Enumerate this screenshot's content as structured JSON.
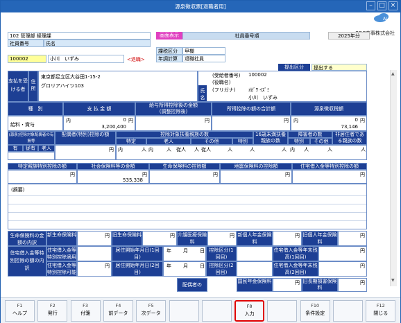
{
  "window": {
    "title": "源泉徴収票[退職者用]"
  },
  "company": "OBC商事株式会社",
  "employee": {
    "dept": "102 管理部 経理課",
    "label_no": "社員番号",
    "label_name": "氏名",
    "no": "100002",
    "name": "小川　いずみ",
    "status": "<退職>",
    "tax_class_label": "課税区分",
    "tax_class": "甲欄",
    "year_end_label": "年調計算",
    "year_end": "退職社員"
  },
  "display": {
    "label": "画面表示",
    "sort": "社員番号順",
    "year": "2025年分"
  },
  "submit": {
    "label": "提出区分",
    "value": "提出する"
  },
  "payee": {
    "label": "支払を受ける者",
    "addr_label": "住所",
    "address1": "東京都足立区大谷田1-15-2",
    "address2": "グロリアハイツ103",
    "recipient_no_label": "(受給者番号)",
    "recipient_no": "100002",
    "post_label": "(役職名)",
    "name_label": "氏名",
    "kana_label": "(フリガナ)",
    "kana": "ｵｶﾞﾜ ｲｽﾞﾐ",
    "name": "小川　いずみ"
  },
  "amounts": {
    "h_type": "種　別",
    "h_pay": "支 払 金 額",
    "h_after": "給与所得控除後の金額",
    "h_after2": "(調整控除後)",
    "h_deduct": "所得控除の額の合計額",
    "h_tax": "源泉徴収税額",
    "type": "給料・賞与",
    "inner": "内",
    "pay_zero": "0",
    "pay": "3,200,400",
    "yen": "円",
    "tax_zero": "0",
    "tax": "73,146"
  },
  "deps": {
    "h_spouse_flag": "(源泉)控除対象配偶者の有無等",
    "h_spouse": "配偶者(特別)控除の額",
    "h_dep_count": "控除対象扶養親族の数",
    "h_under16": "16歳未満扶養親族の数",
    "h_disabled": "障害者の数",
    "h_nonres": "非居住者である親族の数",
    "h_yes": "有",
    "h_junyu": "従有",
    "h_old": "老人",
    "h_special": "特定",
    "h_elder": "老人",
    "h_other": "その他",
    "h_tok": "特別",
    "h_otherd": "その他",
    "inner": "内",
    "person": "人",
    "from": "従人"
  },
  "ins": {
    "h_special_spouse": "特定親族特別控除の額",
    "h_social": "社会保険料等の金額",
    "h_life": "生命保険料の控除額",
    "h_quake": "地震保険料の控除額",
    "h_housing": "住宅借入金等特別控除の額",
    "social": "535,338",
    "yen": "円"
  },
  "memo": {
    "label": "(摘要)"
  },
  "details": {
    "life_breakdown": "生命保険料の金額の内訳",
    "new_life": "新生命保険料",
    "old_life": "旧生命保険料",
    "care": "介護医療保険料",
    "new_pension": "新個人年金保険料",
    "old_pension": "旧個人年金保険料",
    "housing_breakdown": "住宅借入金等特別控除の額の内訳",
    "housing_apply": "住宅借入金等特別控除適用数",
    "housing_possible": "住宅借入金等特別控除可能額",
    "start1": "居住開始年月日(1回目)",
    "start2": "居住開始年月日(2回目)",
    "kind1": "控除区分(1回目)",
    "kind2": "控除区分(2回目)",
    "bal1": "住宅借入金等年末残高(1回目)",
    "bal2": "住宅借入金等年末残高(2回目)",
    "year": "年",
    "month": "月",
    "day": "日",
    "spouse_label": "配偶者の",
    "national_pension": "国民年金保険料",
    "old_longterm": "旧長期損害保険料",
    "yen": "円"
  },
  "fkeys": [
    {
      "n": "F1",
      "l": "ヘルプ"
    },
    {
      "n": "F2",
      "l": "発行"
    },
    {
      "n": "F3",
      "l": "付箋"
    },
    {
      "n": "F4",
      "l": "前データ"
    },
    {
      "n": "F5",
      "l": "次データ"
    },
    {
      "n": "",
      "l": ""
    },
    {
      "n": "",
      "l": ""
    },
    {
      "n": "F8",
      "l": "入力"
    },
    {
      "n": "",
      "l": ""
    },
    {
      "n": "F10",
      "l": "条件設定"
    },
    {
      "n": "",
      "l": ""
    },
    {
      "n": "F12",
      "l": "閉じる"
    }
  ],
  "colors": {
    "title": "#2566b8",
    "header": "#1d3f94",
    "highlight": "#ffff99",
    "focus": "#e00000"
  }
}
